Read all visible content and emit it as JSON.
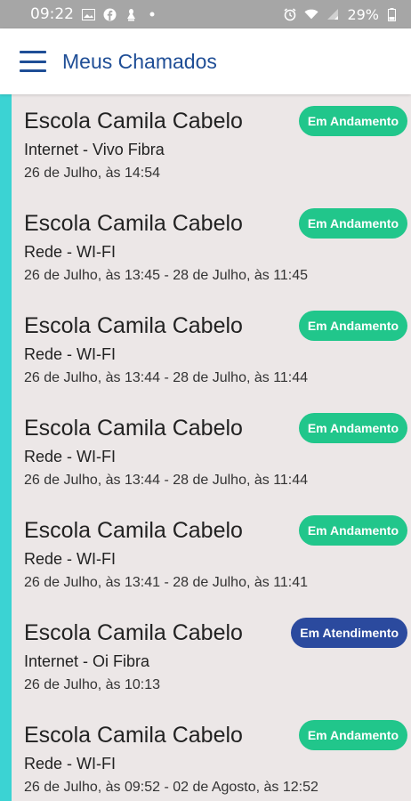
{
  "status_bar": {
    "time": "09:22",
    "battery": "29%",
    "icons": [
      "image-icon",
      "facebook-icon",
      "app-notification-icon",
      "dot-icon",
      "alarm-icon",
      "wifi-icon",
      "signal-icon",
      "battery-icon"
    ]
  },
  "header": {
    "title": "Meus Chamados",
    "menu_icon": "hamburger-menu-icon"
  },
  "colors": {
    "accent": "#3bd3d3",
    "brand": "#1f4e96",
    "status_andamento": "#21c68b",
    "status_atendimento": "#2b4a9e"
  },
  "tickets": [
    {
      "school": "Escola Camila Cabelo",
      "service": "Internet - Vivo Fibra",
      "date": "26 de Julho, às 14:54",
      "status": "Em Andamento",
      "status_color": "#21c68b"
    },
    {
      "school": "Escola Camila Cabelo",
      "service": "Rede - WI-FI",
      "date": "26 de Julho, às 13:45 - 28 de Julho, às 11:45",
      "status": "Em Andamento",
      "status_color": "#21c68b"
    },
    {
      "school": "Escola Camila Cabelo",
      "service": "Rede - WI-FI",
      "date": "26 de Julho, às 13:44 - 28 de Julho, às 11:44",
      "status": "Em Andamento",
      "status_color": "#21c68b"
    },
    {
      "school": "Escola Camila Cabelo",
      "service": "Rede - WI-FI",
      "date": "26 de Julho, às 13:44 - 28 de Julho, às 11:44",
      "status": "Em Andamento",
      "status_color": "#21c68b"
    },
    {
      "school": "Escola Camila Cabelo",
      "service": "Rede - WI-FI",
      "date": "26 de Julho, às 13:41 - 28 de Julho, às 11:41",
      "status": "Em Andamento",
      "status_color": "#21c68b"
    },
    {
      "school": "Escola Camila Cabelo",
      "service": "Internet - Oi Fibra",
      "date": "26 de Julho, às 10:13",
      "status": "Em Atendimento",
      "status_color": "#2b4a9e"
    },
    {
      "school": "Escola Camila Cabelo",
      "service": "Rede - WI-FI",
      "date": "26 de Julho, às 09:52 - 02 de Agosto, às 12:52",
      "status": "Em Andamento",
      "status_color": "#21c68b"
    }
  ]
}
